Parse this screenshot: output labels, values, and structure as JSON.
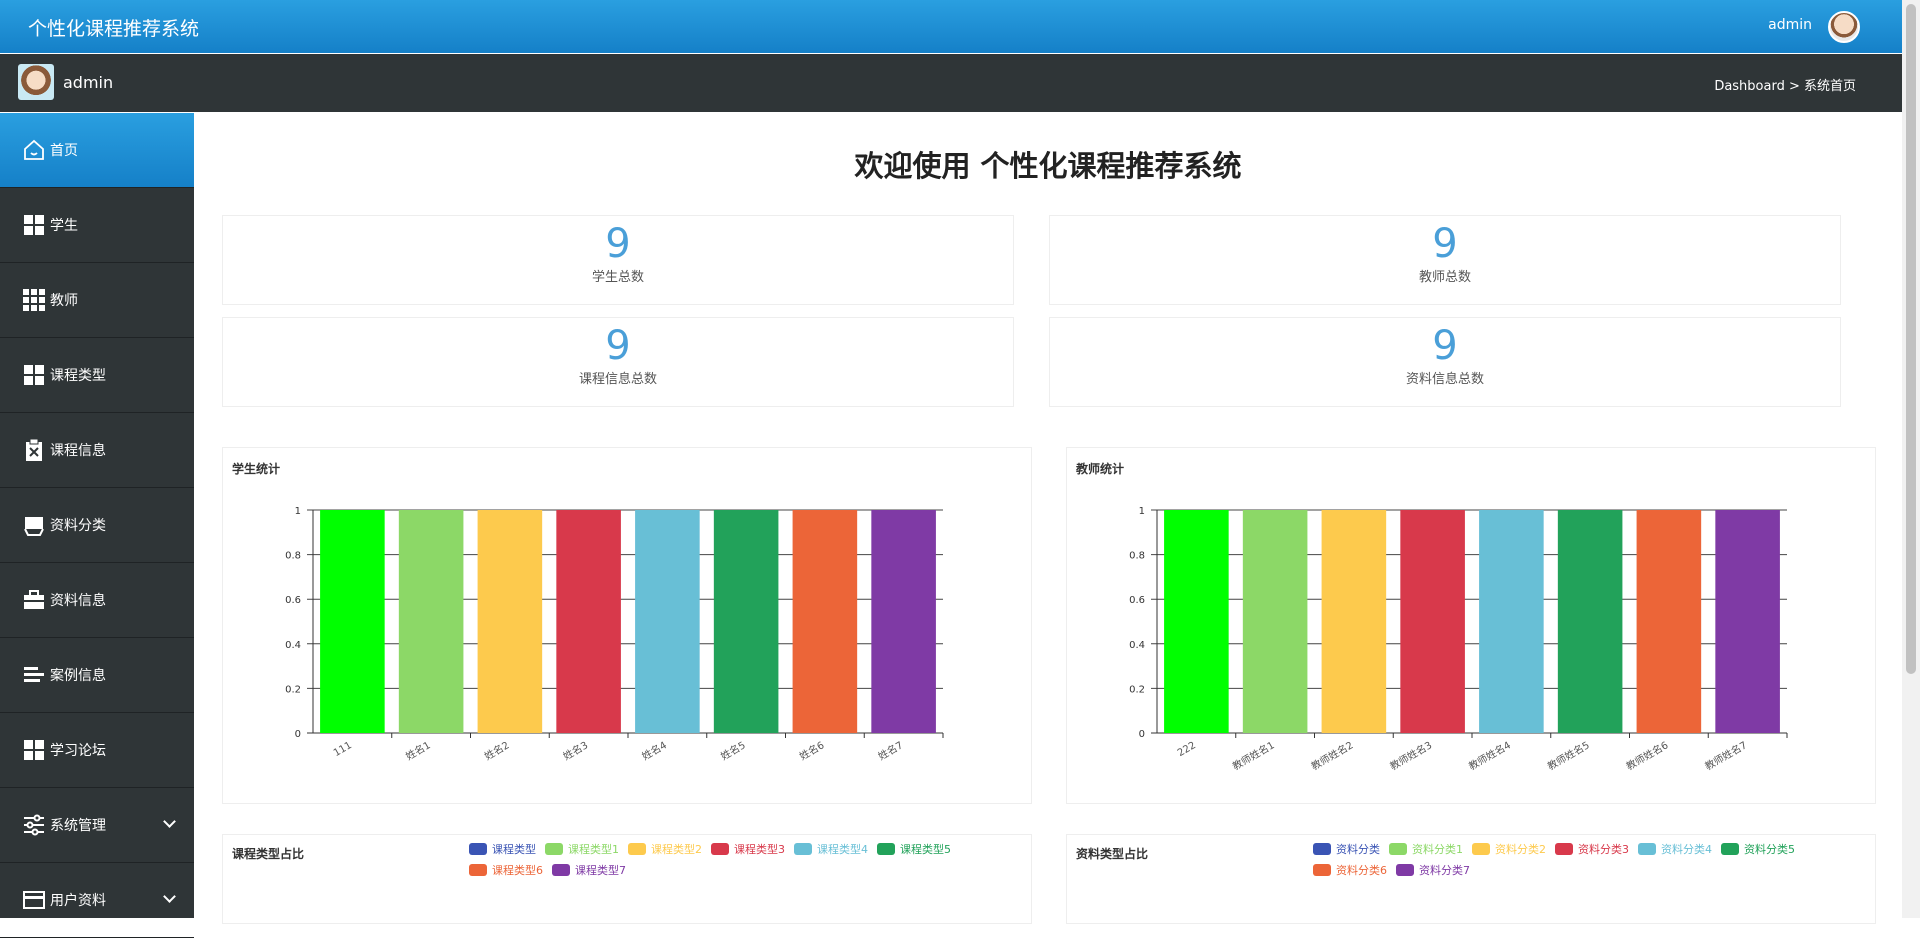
{
  "app": {
    "title": "个性化课程推荐系统",
    "user": "admin"
  },
  "subbar": {
    "name": "admin",
    "breadcrumb": "Dashboard > 系统首页"
  },
  "sidebar": {
    "items": [
      {
        "label": "首页",
        "icon": "home-icon"
      },
      {
        "label": "学生",
        "icon": "grid-icon"
      },
      {
        "label": "教师",
        "icon": "apps-icon"
      },
      {
        "label": "课程类型",
        "icon": "grid-icon"
      },
      {
        "label": "课程信息",
        "icon": "clipboard-icon"
      },
      {
        "label": "资料分类",
        "icon": "inbox-icon"
      },
      {
        "label": "资料信息",
        "icon": "briefcase-icon"
      },
      {
        "label": "案例信息",
        "icon": "list-icon"
      },
      {
        "label": "学习论坛",
        "icon": "grid-icon"
      },
      {
        "label": "系统管理",
        "icon": "sliders-icon"
      },
      {
        "label": "用户资料",
        "icon": "card-icon"
      }
    ]
  },
  "welcome": "欢迎使用 个性化课程推荐系统",
  "stats": [
    {
      "value": "9",
      "label": "学生总数"
    },
    {
      "value": "9",
      "label": "教师总数"
    },
    {
      "value": "9",
      "label": "课程信息总数"
    },
    {
      "value": "9",
      "label": "资料信息总数"
    }
  ],
  "colors": [
    "#00ff00",
    "#8cd867",
    "#fdca4d",
    "#d8394b",
    "#68bfd6",
    "#22a25a",
    "#ec6538",
    "#7f3aa5"
  ],
  "legend_colors": [
    "#3a54b4",
    "#8cd867",
    "#fdca4d",
    "#d8394b",
    "#68bfd6",
    "#22a25a",
    "#ec6538",
    "#7f3aa5"
  ],
  "chart_data": [
    {
      "type": "bar",
      "title": "学生统计",
      "categories": [
        "111",
        "姓名1",
        "姓名2",
        "姓名3",
        "姓名4",
        "姓名5",
        "姓名6",
        "姓名7"
      ],
      "values": [
        1,
        1,
        1,
        1,
        1,
        1,
        1,
        1
      ],
      "ylim": [
        0,
        1
      ],
      "yticks": [
        "0",
        "0.2",
        "0.4",
        "0.6",
        "0.8",
        "1"
      ],
      "grid": true
    },
    {
      "type": "bar",
      "title": "教师统计",
      "categories": [
        "222",
        "教师姓名1",
        "教师姓名2",
        "教师姓名3",
        "教师姓名4",
        "教师姓名5",
        "教师姓名6",
        "教师姓名7"
      ],
      "values": [
        1,
        1,
        1,
        1,
        1,
        1,
        1,
        1
      ],
      "ylim": [
        0,
        1
      ],
      "yticks": [
        "0",
        "0.2",
        "0.4",
        "0.6",
        "0.8",
        "1"
      ],
      "grid": true
    },
    {
      "type": "pie",
      "title": "课程类型占比",
      "legend": [
        "课程类型",
        "课程类型1",
        "课程类型2",
        "课程类型3",
        "课程类型4",
        "课程类型5",
        "课程类型6",
        "课程类型7"
      ]
    },
    {
      "type": "pie",
      "title": "资料类型占比",
      "legend": [
        "资料分类",
        "资料分类1",
        "资料分类2",
        "资料分类3",
        "资料分类4",
        "资料分类5",
        "资料分类6",
        "资料分类7"
      ]
    }
  ]
}
